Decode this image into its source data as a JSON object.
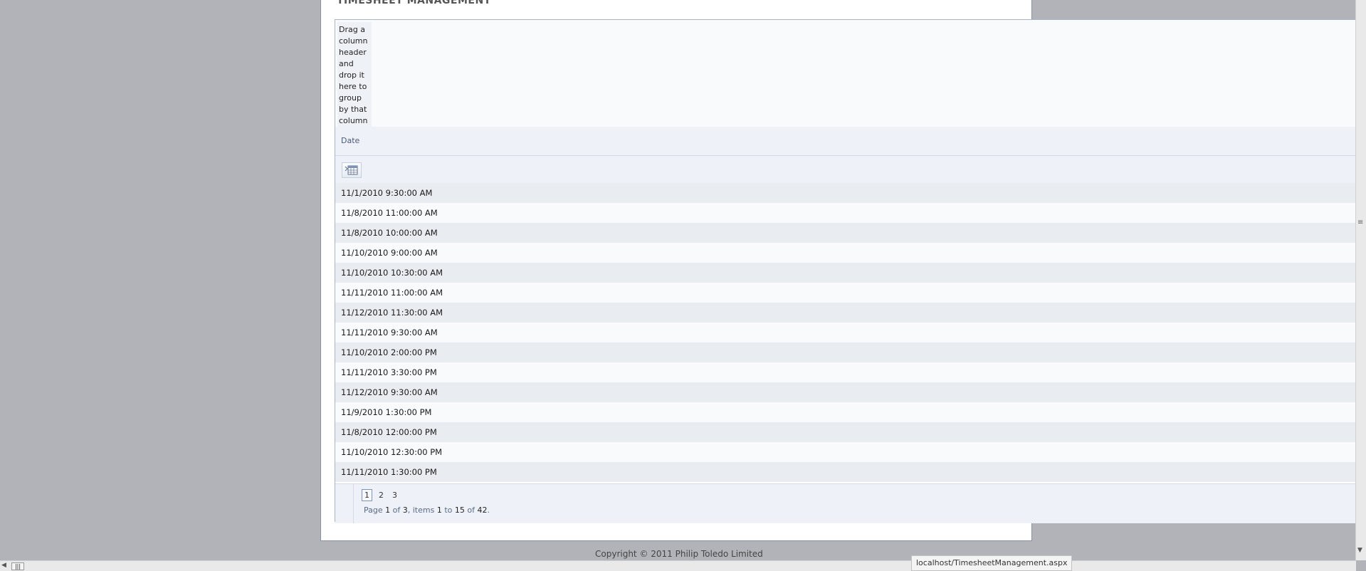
{
  "page": {
    "title": "TIMESHEET MANAGEMENT",
    "copyright": "Copyright © 2011 Philip Toledo Limited"
  },
  "grid": {
    "group_hint": "Drag a column header and drop it here to group by that column",
    "column_header": "Date",
    "filter_icon": "calendar-filter-icon",
    "rows": [
      "11/1/2010 9:30:00 AM",
      "11/8/2010 11:00:00 AM",
      "11/8/2010 10:00:00 AM",
      "11/10/2010 9:00:00 AM",
      "11/10/2010 10:30:00 AM",
      "11/11/2010 11:00:00 AM",
      "11/12/2010 11:30:00 AM",
      "11/11/2010 9:30:00 AM",
      "11/10/2010 2:00:00 PM",
      "11/11/2010 3:30:00 PM",
      "11/12/2010 9:30:00 AM",
      "11/9/2010 1:30:00 PM",
      "11/8/2010 12:00:00 PM",
      "11/10/2010 12:30:00 PM",
      "11/11/2010 1:30:00 PM"
    ],
    "pager": {
      "pages": [
        "1",
        "2",
        "3"
      ],
      "current_page": "1",
      "info": {
        "prefix": "Page",
        "page": "1",
        "of_label": "of",
        "total_pages": "3",
        "items_label": ", items",
        "from": "1",
        "to_label": "to",
        "to": "15",
        "total_label": "of",
        "total": "42",
        "end": "."
      }
    }
  },
  "browser": {
    "status_url": "localhost/TimesheetManagement.aspx"
  }
}
